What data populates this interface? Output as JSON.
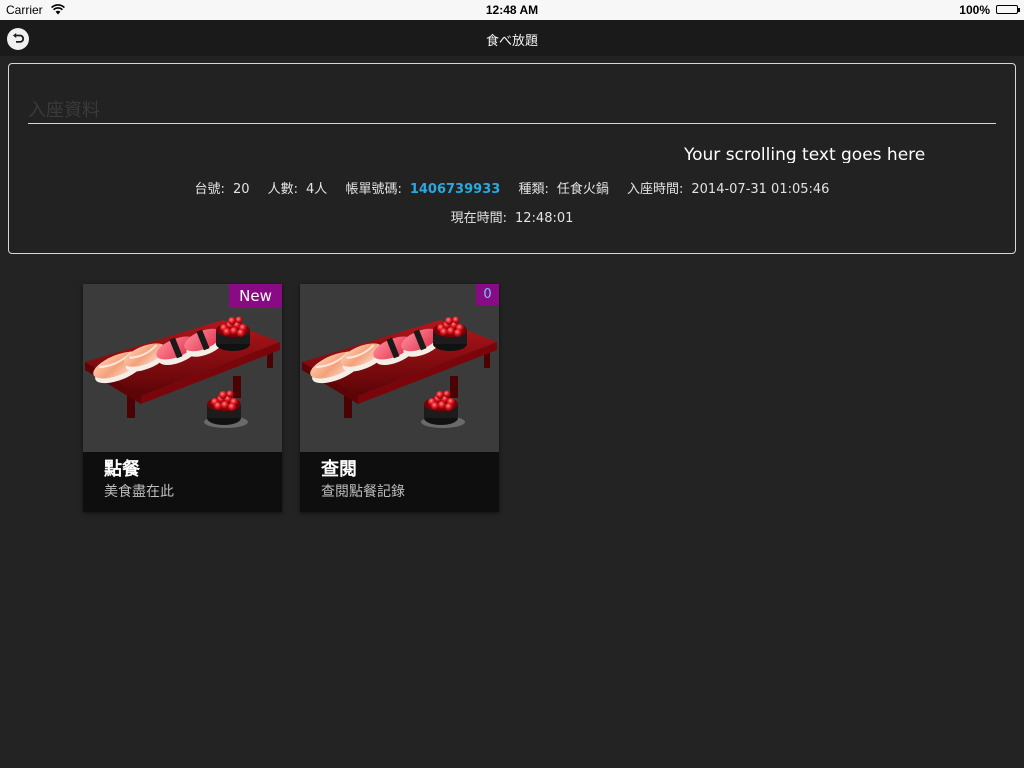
{
  "status_bar": {
    "carrier": "Carrier",
    "time": "12:48 AM",
    "battery": "100%",
    "battery_level": 1.0
  },
  "nav": {
    "title": "食べ放題",
    "back_icon": "back-arrow-icon"
  },
  "info": {
    "title": "入座資料",
    "scrolling_text": "Your scrolling text goes here",
    "table_label": "台號:",
    "table_value": "20",
    "guests_label": "人數:",
    "guests_value": "4人",
    "bill_label": "帳單號碼:",
    "bill_value": "1406739933",
    "type_label": "種類:",
    "type_value": "任食火鍋",
    "seated_label": "入座時間:",
    "seated_value": "2014-07-31 01:05:46",
    "now_label": "現在時間:",
    "now_value": "12:48:01",
    "accent_color": "#2aa8e0"
  },
  "tiles": [
    {
      "title": "點餐",
      "subtitle": "美食盡在此",
      "badge": "New",
      "image": "sushi-platter-image"
    },
    {
      "title": "查閱",
      "subtitle": "查閱點餐記錄",
      "badge": "0",
      "image": "sushi-platter-image"
    }
  ],
  "colors": {
    "background": "#232323",
    "badge": "#8a0a86"
  }
}
